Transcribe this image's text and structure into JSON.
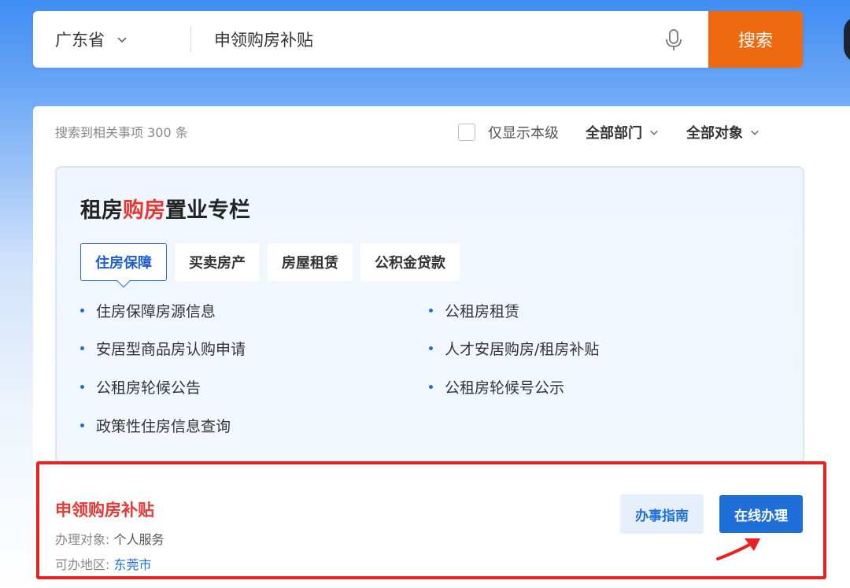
{
  "search": {
    "region": "广东省",
    "query": "申领购房补贴",
    "button_label": "搜索"
  },
  "results": {
    "count_text": "搜索到相关事项 300 条",
    "only_level_label": "仅显示本级",
    "department_filter": "全部部门",
    "target_filter": "全部对象"
  },
  "column": {
    "title_prefix": "租房",
    "title_highlight": "购房",
    "title_suffix": "置业专栏",
    "tabs": [
      {
        "label": "住房保障",
        "active": true
      },
      {
        "label": "买卖房产",
        "active": false
      },
      {
        "label": "房屋租赁",
        "active": false
      },
      {
        "label": "公积金贷款",
        "active": false
      }
    ],
    "services": [
      "住房保障房源信息",
      "公租房租赁",
      "安居型商品房认购申请",
      "人才安居购房/租房补贴",
      "公租房轮候公告",
      "公租房轮候号公示",
      "政策性住房信息查询"
    ]
  },
  "result_item": {
    "title": "申领购房补贴",
    "target_label": "办理对象:",
    "target_value": "个人服务",
    "region_label": "可办地区:",
    "region_value": "东莞市",
    "guide_button": "办事指南",
    "online_button": "在线办理"
  },
  "colors": {
    "accent_orange": "#ee6a10",
    "primary_blue": "#1e6fd8",
    "highlight_red": "#e53935",
    "annotation_red": "#e82121"
  },
  "icons": [
    "chevron-down-icon",
    "microphone-icon",
    "arrow-annotation-icon"
  ]
}
